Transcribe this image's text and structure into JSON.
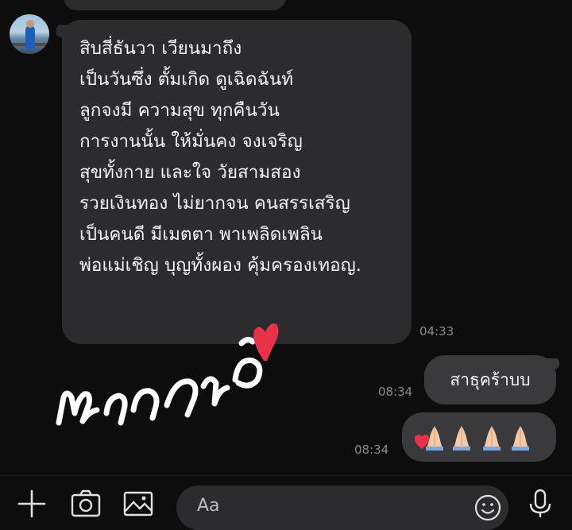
{
  "chat": {
    "incoming": {
      "text": "สิบสี่ธันวา เวียนมาถึง\nเป็นวันซึ่ง ตั้มเกิด ดูเฉิดฉันท์\nลูกจงมี ความสุข ทุกคืนวัน\nการงานนั้น ให้มั่นคง จงเจริญ\nสุขทั้งกาย และใจ วัยสามสอง\nรวยเงินทอง ไม่ยากจน คนสรรเสริญ\nเป็นคนดี มีเมตตา พาเพลิดเพลิน\nพ่อแม่เชิญ บุญทั้งผอง คุ้มครองเทอญ.",
      "time": "04:33"
    },
    "outgoing": [
      {
        "text": "สาธุคร้าบบ",
        "time": "08:34"
      },
      {
        "emoji": "pray-pray-pray-pray",
        "time": "08:34"
      }
    ],
    "overlay": {
      "handwriting_text": "พรจากพ่อ"
    }
  },
  "toolbar": {
    "icons": [
      "plus-icon",
      "camera-icon",
      "image-icon",
      "emoji-icon",
      "microphone-icon"
    ],
    "input_placeholder": "Aa"
  },
  "colors": {
    "background": "#0d0d0d",
    "bubble_in": "#2c2c2e",
    "bubble_out": "#3a3a3c",
    "heart": "#e8324a"
  }
}
